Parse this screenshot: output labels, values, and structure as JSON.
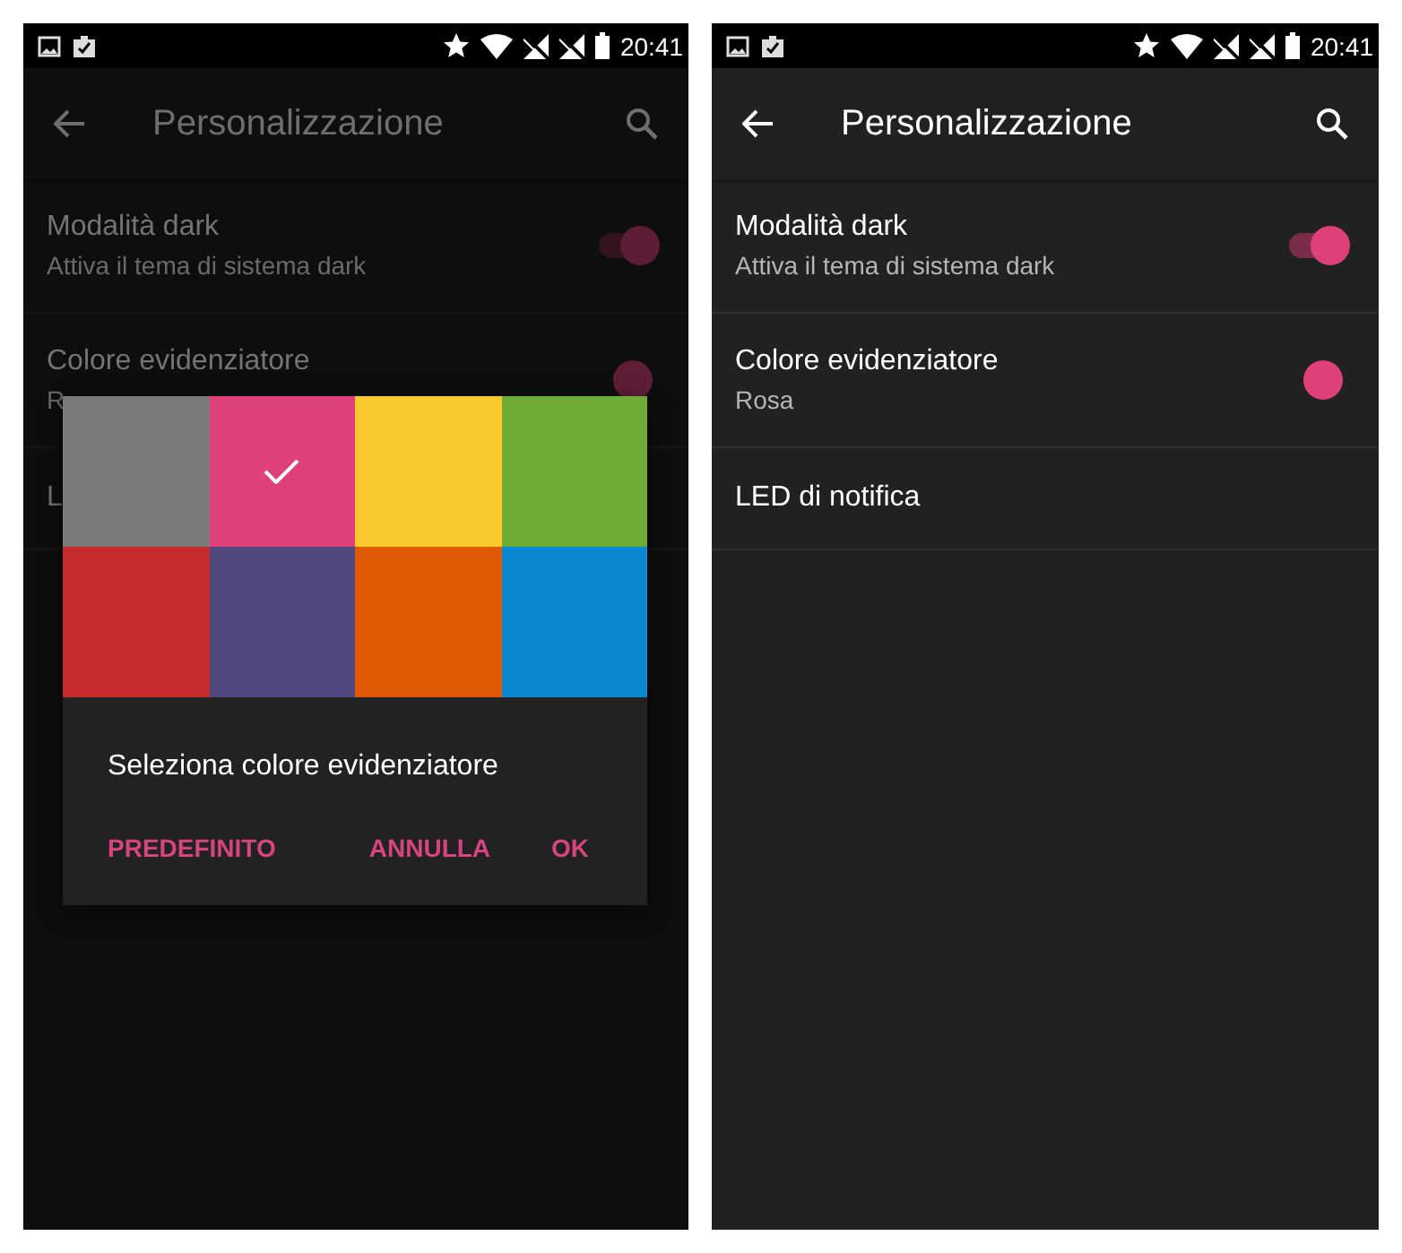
{
  "screens": [
    {
      "status_bar": {
        "time": "20:41"
      },
      "toolbar": {
        "title": "Personalizzazione"
      },
      "dimmed": true,
      "settings": [
        {
          "kind": "switch",
          "title": "Modalità dark",
          "subtitle": "Attiva il tema di sistema dark",
          "on": true
        },
        {
          "kind": "color",
          "title": "Colore evidenziatore",
          "subtitle": "R",
          "color": "#5e1d36"
        },
        {
          "kind": "plain",
          "title": "L"
        }
      ],
      "dialog": {
        "swatches": [
          {
            "color": "#7a7a7a",
            "selected": false
          },
          {
            "color": "#e0407a",
            "selected": true
          },
          {
            "color": "#f9c92e",
            "selected": false
          },
          {
            "color": "#6dac35",
            "selected": false
          },
          {
            "color": "#c62c2e",
            "selected": false
          },
          {
            "color": "#4f477e",
            "selected": false
          },
          {
            "color": "#e05a06",
            "selected": false
          },
          {
            "color": "#0a89d2",
            "selected": false
          }
        ],
        "message": "Seleziona colore evidenziatore",
        "buttons": [
          "PREDEFINITO",
          "ANNULLA",
          "OK"
        ]
      }
    },
    {
      "status_bar": {
        "time": "20:41"
      },
      "toolbar": {
        "title": "Personalizzazione"
      },
      "dimmed": false,
      "settings": [
        {
          "kind": "switch",
          "title": "Modalità dark",
          "subtitle": "Attiva il tema di sistema dark",
          "on": true
        },
        {
          "kind": "color",
          "title": "Colore evidenziatore",
          "subtitle": "Rosa",
          "color": "#e0407a"
        },
        {
          "kind": "plain",
          "title": "LED di notifica"
        }
      ]
    }
  ]
}
